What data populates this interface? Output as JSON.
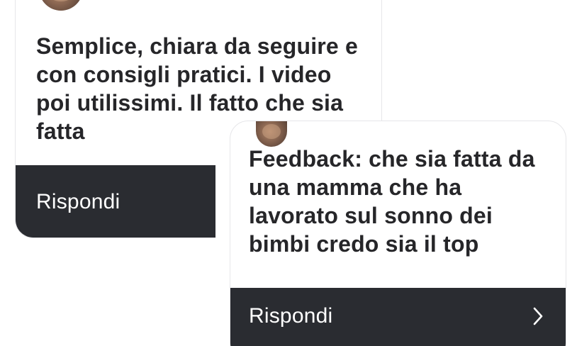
{
  "back_card": {
    "message": "Semplice, chiara da seguire e con consigli pratici. I video poi utilissimi. Il fatto che sia fatta",
    "reply_label": "Rispondi"
  },
  "front_card": {
    "message": "Feedback: che sia fatta da una mamma che ha lavorato sul sonno dei bimbi credo sia il top",
    "reply_label": "Rispondi",
    "chevron_icon": "chevron-right-icon"
  },
  "colors": {
    "card_background": "#ffffff",
    "footer_background": "#2a2c31",
    "message_text": "#262629",
    "footer_text": "#ffffff"
  }
}
